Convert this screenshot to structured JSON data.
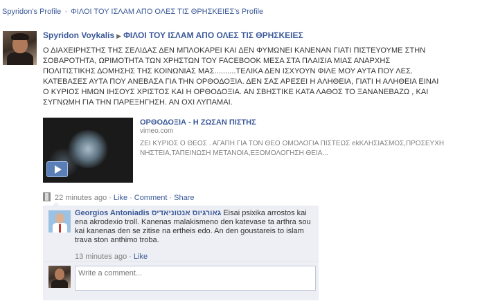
{
  "breadcrumb": {
    "first": "Spyridon's Profile",
    "separator": "·",
    "second": "ΦΙΛΟΙ ΤΟΥ ΙΣΛΑΜ ΑΠΟ ΟΛΕΣ ΤΙΣ ΘΡΗΣΚΕΙΕΣ's Profile"
  },
  "post": {
    "author": "Spyridon Voykalis",
    "target": "ΦΙΛΟΙ ΤΟΥ ΙΣΛΑΜ ΑΠΟ ΟΛΕΣ ΤΙΣ ΘΡΗΣΚΕΙΕΣ",
    "arrow_icon": "triangle-right-icon",
    "text_lines": [
      "Ο ΔΙΑΧΕΙΡΗΣΤΗΣ ΤΗΣ ΣΕΛΙΔΑΣ ΔΕΝ ΜΠΛΟΚΑΡΕΙ ΚΑΙ ΔΕΝ ΦΥΜΩΝΕΙ ΚΑΝΕΝΑΝ ΓΙΑΤΙ ΠΙΣΤΕΥΟΥΜΕ ΣΤΗΝ",
      "ΣΟΒΑΡΟΤΗΤΑ, ΩΡΙΜΟΤΗΤΑ ΤΩΝ ΧΡΗΣΤΩΝ ΤΟΥ FACEBOOK ΜΕΣΑ ΣΤΑ ΠΛΑΙΣΙΑ ΜΙΑΣ ΑΝΑΡΧΗΣ",
      "ΠΟΛΙΤΙΣΤΙΚΗΣ ΔΟΜΗΣΗΣ ΤΗΣ ΚΟΙΝΩΝΙΑΣ ΜΑΣ..........ΤΕΛΙΚΑ ΔΕΝ ΙΣΧΥΟΥΝ ΦΙΛΕ ΜΟΥ ΑΥΤΑ ΠΟΥ ΛΕΣ.",
      "ΚΑΤΕΒΑΣΕΣ ΑΥΤΑ ΠΟΥ ΑΝΕΒΑΣΑ ΓΙΑ ΤΗΝ ΟΡΘΟΔΟΞΙΑ. ΔΕΝ ΣΑΣ ΑΡΕΣΕΙ Η ΑΛΗΘΕΙΑ, ΓΙΑΤΙ Η ΑΛΗΘΕΙΑ ΕΙΝΑΙ",
      "Ο ΚΥΡΙΟΣ ΗΜΩΝ ΙΗΣΟΥΣ ΧΡΙΣΤΟΣ ΚΑΙ Η ΟΡΘΟΔΟΞΙΑ. ΑΝ ΣΒΗΣΤΙΚΕ ΚΑΤΑ ΛΑΘΟΣ ΤΟ ΞΑΝΑΝΕΒΑΖΩ , ΚΑΙ",
      "ΣΥΓΝΩΜΗ ΓΙΑ ΤΗΝ ΠΑΡΕΞΗΓΗΣΗ. ΑΝ ΟΧΙ ΛΥΠΑΜΑΙ."
    ]
  },
  "attachment": {
    "title": "ΟΡΘΟΔΟΞΙΑ - Η ΖΩΣΑΝ ΠΙΣΤΗΣ",
    "source": "vimeo.com",
    "description_lines": [
      "ΖΕΙ ΚΥΡΙΟΣ Ο ΘΕΟΣ . ΑΓΑΠΗ ΓΙΑ ΤΟΝ ΘΕΟ ΟΜΟΛΟΓΙΑ ΠΙΣΤΕΩΣ ekΚΛΗΣΙΑΣΜΟΣ,ΠΡΟΣΕΥΧΗ",
      "ΝΗΣΤΕΙΑ,ΤΑΠΕΙΝΩΣΗ ΜΕΤΑΝΟΙΑ,ΕΞΟΜΟΛΟΓΗΣΗ ΘΕΙΑ..."
    ],
    "play_icon": "play-icon"
  },
  "meta": {
    "time": "22 minutes ago",
    "like": "Like",
    "comment": "Comment",
    "share": "Share",
    "dot": "·",
    "type_icon": "film-icon"
  },
  "comments": [
    {
      "author": "Georgios Antoniadis גאורגיוס אנטוניאדיס",
      "text": "Eisai psixika arrostos kai ena akrodexio troll. Kanenas malakismeno den katevase ta arthra sou kai kanenas den se zitise na ertheis edo. An den goustareis to islam trava ston anthimo troba.",
      "time": "13 minutes ago",
      "like": "Like"
    }
  ],
  "reply": {
    "placeholder": "Write a comment..."
  }
}
